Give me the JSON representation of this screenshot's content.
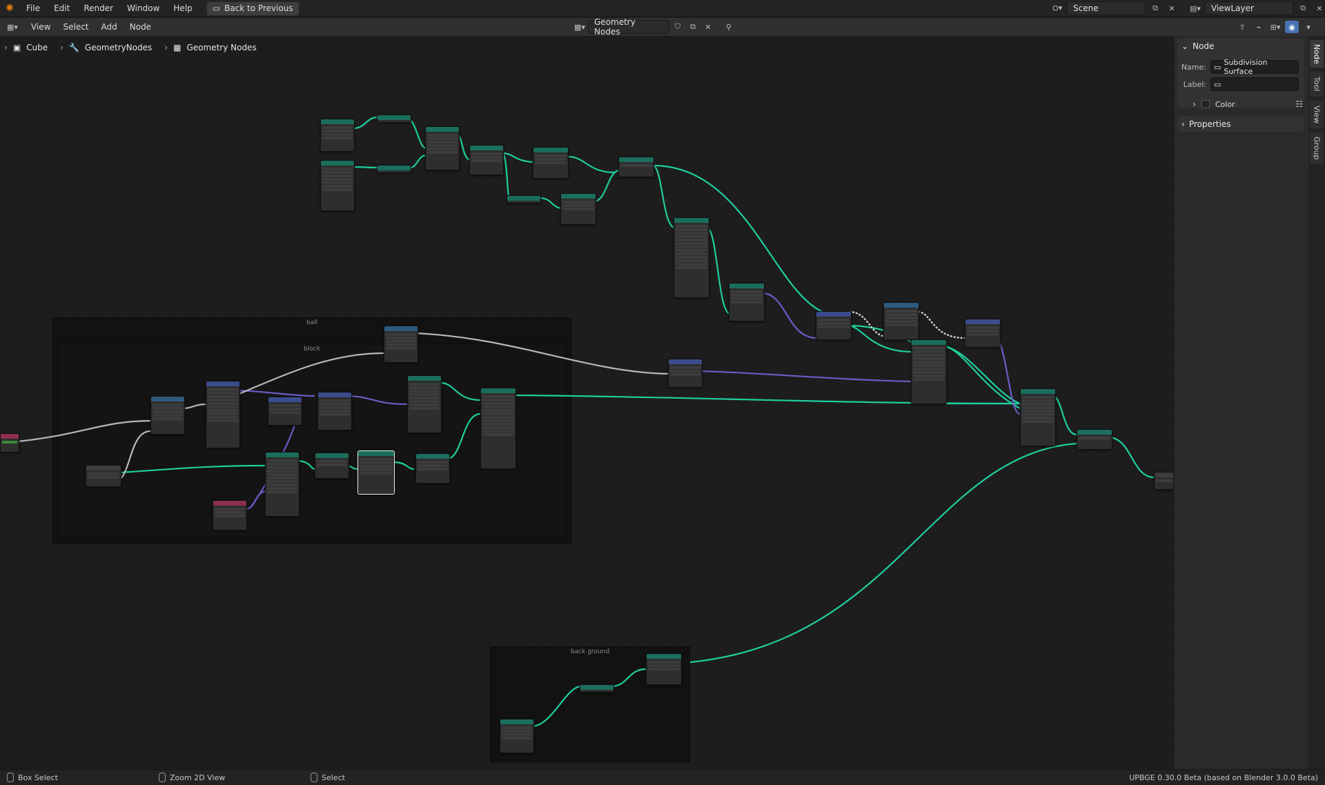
{
  "menubar": {
    "items": [
      "File",
      "Edit",
      "Render",
      "Window",
      "Help"
    ],
    "back_button": "Back to Previous",
    "scene": "Scene",
    "view_layer": "ViewLayer"
  },
  "editor_header": {
    "menus": [
      "View",
      "Select",
      "Add",
      "Node"
    ],
    "node_tree_name": "Geometry Nodes"
  },
  "breadcrumb": {
    "object": "Cube",
    "modifier": "GeometryNodes",
    "node_group": "Geometry Nodes"
  },
  "sidebar": {
    "tabs": [
      "Node",
      "Tool",
      "View",
      "Group"
    ],
    "node_panel": {
      "title": "Node",
      "name_label": "Name:",
      "name_value": "Subdivision Surface",
      "label_label": "Label:",
      "label_value": "",
      "color_label": "Color"
    },
    "properties_panel": {
      "title": "Properties"
    }
  },
  "frames": {
    "ball": "ball",
    "block": "block",
    "background": "back ground"
  },
  "statusbar": {
    "box_select": "Box Select",
    "zoom": "Zoom 2D View",
    "select": "Select",
    "version": "UPBGE 0.30.0 Beta (based on Blender 3.0.0 Beta)"
  },
  "colors": {
    "geometry_link": "#1fcf9f",
    "vector_link": "#6c5cc7",
    "float_link": "#a0a0a0",
    "accent": "#4772b3"
  }
}
